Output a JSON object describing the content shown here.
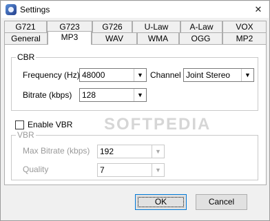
{
  "window": {
    "title": "Settings",
    "close_glyph": "✕"
  },
  "tabs": {
    "row1": [
      "G721",
      "G723",
      "G726",
      "U-Law",
      "A-Law",
      "VOX"
    ],
    "row2": [
      "General",
      "MP3",
      "WAV",
      "WMA",
      "OGG",
      "MP2"
    ],
    "active": "MP3"
  },
  "cbr": {
    "title": "CBR",
    "frequency_label": "Frequency (Hz)",
    "frequency_value": "48000",
    "channel_label": "Channel",
    "channel_value": "Joint Stereo",
    "bitrate_label": "Bitrate (kbps)",
    "bitrate_value": "128"
  },
  "vbr_checkbox": {
    "label": "Enable VBR",
    "checked": false
  },
  "vbr": {
    "title": "VBR",
    "max_bitrate_label": "Max Bitrate (kbps)",
    "max_bitrate_value": "192",
    "quality_label": "Quality",
    "quality_value": "7"
  },
  "buttons": {
    "ok": "OK",
    "cancel": "Cancel"
  },
  "watermark": "SOFTPEDIA"
}
